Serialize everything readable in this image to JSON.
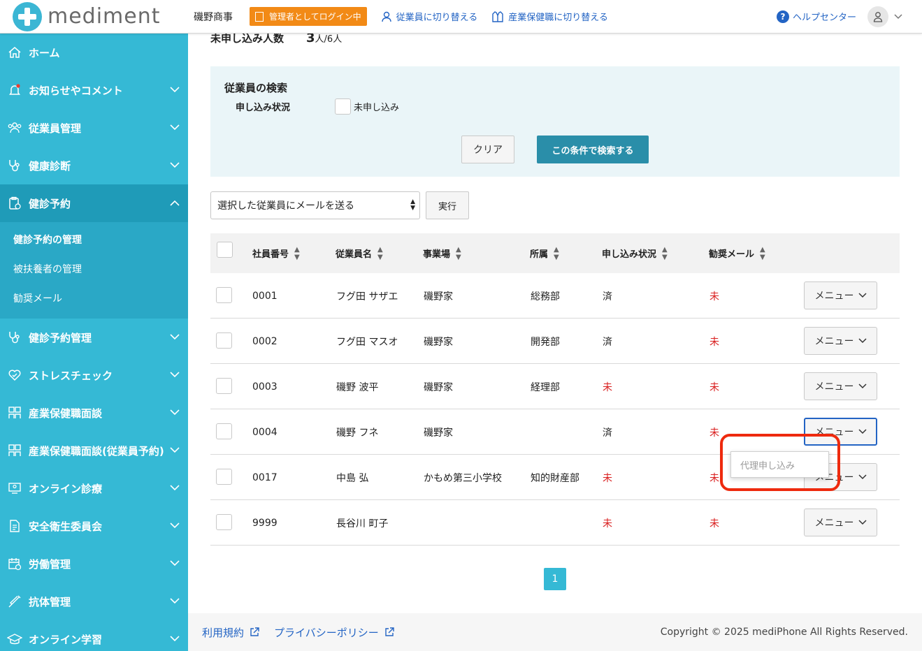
{
  "header": {
    "logo_text": "mediment",
    "company": "磯野商事",
    "admin_badge": "管理者としてログイン中",
    "switch_employee": "従業員に切り替える",
    "switch_occupational": "産業保健職に切り替える",
    "help": "ヘルプセンター"
  },
  "sidebar": {
    "items": [
      {
        "label": "ホーム",
        "icon": "home-icon"
      },
      {
        "label": "お知らせやコメント",
        "icon": "bell-icon"
      },
      {
        "label": "従業員管理",
        "icon": "people-icon"
      },
      {
        "label": "健康診断",
        "icon": "stethoscope-icon"
      },
      {
        "label": "健診予約",
        "icon": "clipboard-icon"
      },
      {
        "label": "健診予約管理",
        "icon": "stethoscope-icon"
      },
      {
        "label": "ストレスチェック",
        "icon": "heart-icon"
      },
      {
        "label": "産業保健職面談",
        "icon": "people-icon"
      },
      {
        "label": "産業保健職面談(従業員予約)",
        "icon": "people-icon"
      },
      {
        "label": "オンライン診療",
        "icon": "monitor-icon"
      },
      {
        "label": "安全衛生委員会",
        "icon": "document-icon"
      },
      {
        "label": "労働管理",
        "icon": "calendar-icon"
      },
      {
        "label": "抗体管理",
        "icon": "syringe-icon"
      },
      {
        "label": "オンライン学習",
        "icon": "graduation-icon"
      }
    ],
    "sub_items": [
      "健診予約の管理",
      "被扶養者の管理",
      "勧奨メール"
    ]
  },
  "summary": {
    "label": "未申し込み人数",
    "count": "3",
    "unit": "人/6人"
  },
  "search": {
    "title": "従業員の検索",
    "status_label": "申し込み状況",
    "unapplied_label": "未申し込み",
    "clear": "クリア",
    "submit": "この条件で検索する"
  },
  "bulk": {
    "selected": "選択した従業員にメールを送る",
    "exec": "実行"
  },
  "table": {
    "headers": [
      "社員番号",
      "従業員名",
      "事業場",
      "所属",
      "申し込み状況",
      "勧奨メール"
    ],
    "menu_label": "メニュー",
    "rows": [
      [
        "0001",
        "フグ田 サザエ",
        "磯野家",
        "総務部",
        "済",
        "未"
      ],
      [
        "0002",
        "フグ田 マスオ",
        "磯野家",
        "開発部",
        "済",
        "未"
      ],
      [
        "0003",
        "磯野 波平",
        "磯野家",
        "経理部",
        "未",
        "未"
      ],
      [
        "0004",
        "磯野 フネ",
        "磯野家",
        "",
        "済",
        "未"
      ],
      [
        "0017",
        "中島 弘",
        "かもめ第三小学校",
        "知的財産部",
        "未",
        "未"
      ],
      [
        "9999",
        "長谷川 町子",
        "",
        "",
        "未",
        "未"
      ]
    ]
  },
  "dropdown": {
    "item": "代理申し込み"
  },
  "pagination": {
    "current": "1"
  },
  "footer": {
    "terms": "利用規約",
    "privacy": "プライバシーポリシー",
    "copyright": "Copyright © 2025 mediPhone All Rights Reserved."
  },
  "colors": {
    "sidebar": "#35b9d5",
    "sidebar_active": "#1f9bb8",
    "primary_button": "#2a8ea9",
    "admin_badge": "#f28a16",
    "link": "#2364c4",
    "alert_red": "#d92020",
    "highlight": "#ee2a0e"
  }
}
